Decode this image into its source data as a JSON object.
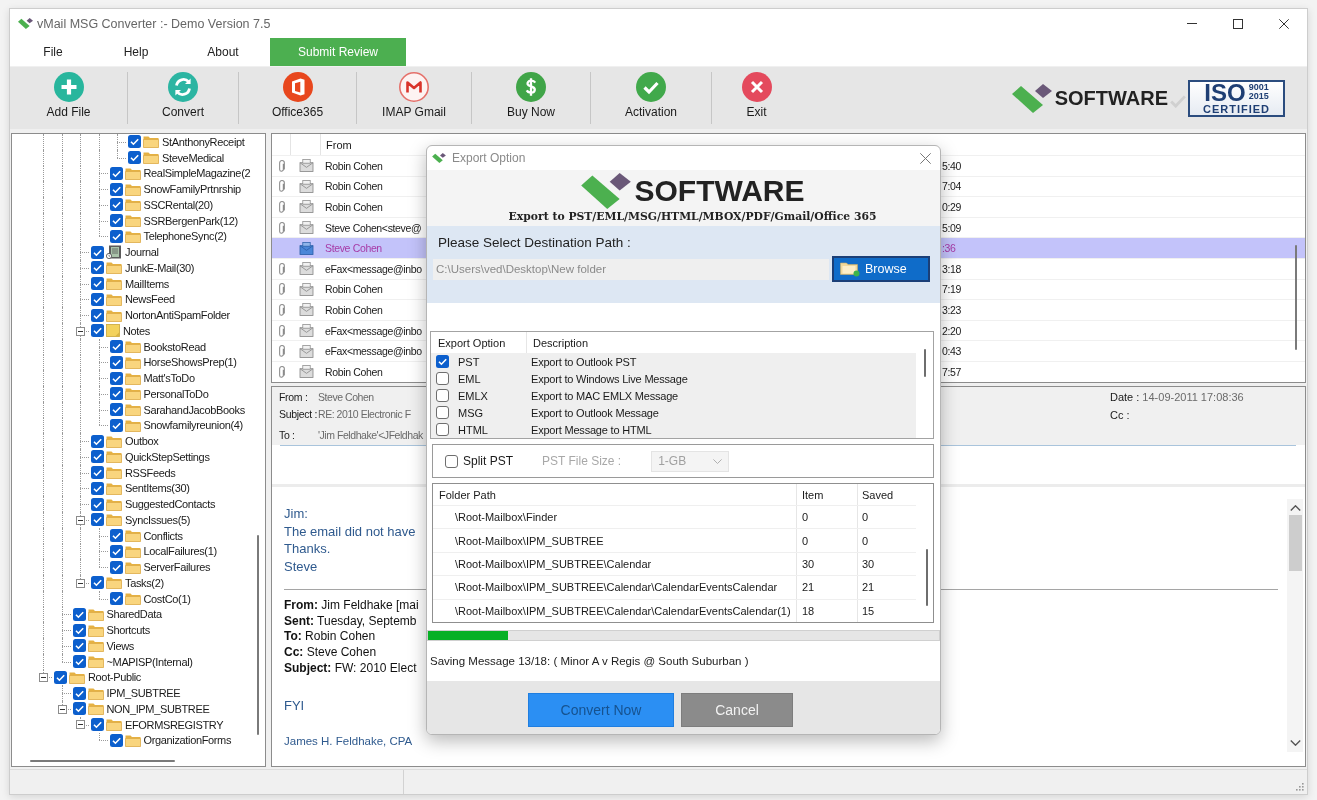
{
  "window": {
    "title": "vMail MSG Converter :- Demo Version 7.5"
  },
  "menu": [
    {
      "label": "File",
      "kind": "menu"
    },
    {
      "label": "Help",
      "kind": "menu"
    },
    {
      "label": "About",
      "kind": "menu"
    },
    {
      "label": "Submit Review",
      "kind": "action"
    }
  ],
  "toolbar": {
    "buttons": [
      {
        "label": "Add File",
        "kind": "add"
      },
      {
        "label": "Convert",
        "kind": "convert"
      },
      {
        "label": "Office365",
        "kind": "office"
      },
      {
        "label": "IMAP Gmail",
        "kind": "gmail"
      },
      {
        "label": "Buy Now",
        "kind": "buy"
      },
      {
        "label": "Activation",
        "kind": "activate"
      },
      {
        "label": "Exit",
        "kind": "exit"
      }
    ],
    "brand": "SOFTWARE",
    "iso_badge": {
      "mark": "ISO",
      "standard": "9001",
      "year": "2015",
      "caption": "CERTIFIED"
    }
  },
  "folder_tree": {
    "items": [
      {
        "children": [
          {
            "children": [
              {
                "children": [
                  {
                    "children": [
                      {
                        "label": "StAnthonyReceipt",
                        "kind": "folder",
                        "checked": true
                      },
                      {
                        "label": "SteveMedical",
                        "kind": "folder",
                        "checked": true
                      }
                    ]
                  },
                  {
                    "label": "RealSimpleMagazine(2",
                    "kind": "folder",
                    "checked": true
                  },
                  {
                    "label": "SnowFamilyPrtnrship",
                    "kind": "folder",
                    "checked": true
                  },
                  {
                    "label": "SSCRental(20)",
                    "kind": "folder",
                    "checked": true
                  },
                  {
                    "label": "SSRBergenPark(12)",
                    "kind": "folder",
                    "checked": true
                  },
                  {
                    "label": "TelephoneSync(2)",
                    "kind": "folder",
                    "checked": true
                  }
                ]
              },
              {
                "label": "Journal",
                "kind": "journal",
                "checked": true
              },
              {
                "label": "JunkE-Mail(30)",
                "kind": "folder",
                "checked": true
              },
              {
                "label": "MailItems",
                "kind": "folder",
                "checked": true
              },
              {
                "label": "NewsFeed",
                "kind": "folder",
                "checked": true
              },
              {
                "label": "NortonAntiSpamFolder",
                "kind": "folder",
                "checked": true
              },
              {
                "label": "Notes",
                "kind": "notes",
                "checked": true,
                "expanded": true,
                "children": [
                  {
                    "label": "BookstoRead",
                    "kind": "folder",
                    "checked": true
                  },
                  {
                    "label": "HorseShowsPrep(1)",
                    "kind": "folder",
                    "checked": true
                  },
                  {
                    "label": "Matt'sToDo",
                    "kind": "folder",
                    "checked": true
                  },
                  {
                    "label": "PersonalToDo",
                    "kind": "folder",
                    "checked": true
                  },
                  {
                    "label": "SarahandJacobBooks",
                    "kind": "folder",
                    "checked": true
                  },
                  {
                    "label": "Snowfamilyreunion(4)",
                    "kind": "folder",
                    "checked": true
                  }
                ]
              },
              {
                "label": "Outbox",
                "kind": "folder",
                "checked": true
              },
              {
                "label": "QuickStepSettings",
                "kind": "folder",
                "checked": true
              },
              {
                "label": "RSSFeeds",
                "kind": "folder",
                "checked": true
              },
              {
                "label": "SentItems(30)",
                "kind": "folder",
                "checked": true
              },
              {
                "label": "SuggestedContacts",
                "kind": "folder",
                "checked": true
              },
              {
                "label": "SyncIssues(5)",
                "kind": "folder",
                "checked": true,
                "expanded": true,
                "children": [
                  {
                    "label": "Conflicts",
                    "kind": "folder",
                    "checked": true
                  },
                  {
                    "label": "LocalFailures(1)",
                    "kind": "folder",
                    "checked": true
                  },
                  {
                    "label": "ServerFailures",
                    "kind": "folder",
                    "checked": true
                  }
                ]
              },
              {
                "label": "Tasks(2)",
                "kind": "folder",
                "checked": true,
                "expanded": true,
                "children": [
                  {
                    "label": "CostCo(1)",
                    "kind": "folder",
                    "checked": true
                  }
                ]
              }
            ]
          },
          {
            "label": "SharedData",
            "kind": "folder",
            "checked": true
          },
          {
            "label": "Shortcuts",
            "kind": "folder",
            "checked": true
          },
          {
            "label": "Views",
            "kind": "folder",
            "checked": true
          },
          {
            "label": "~MAPISP(Internal)",
            "kind": "folder",
            "checked": true
          }
        ]
      },
      {
        "label": "Root-Public",
        "kind": "folder",
        "checked": true,
        "expanded": true,
        "children": [
          {
            "label": "IPM_SUBTREE",
            "kind": "folder",
            "checked": true
          },
          {
            "label": "NON_IPM_SUBTREE",
            "kind": "folder",
            "checked": true,
            "expanded": true,
            "children": [
              {
                "label": "EFORMSREGISTRY",
                "kind": "folder",
                "checked": true,
                "expanded": true,
                "children": [
                  {
                    "label": "OrganizationForms",
                    "kind": "folder",
                    "checked": true
                  }
                ]
              }
            ]
          }
        ]
      }
    ]
  },
  "message_list": {
    "columns": [
      {
        "label": "From"
      }
    ],
    "rows": [
      {
        "attachment": true,
        "from": "Robin Cohen",
        "date": "5:40",
        "selected": false
      },
      {
        "attachment": true,
        "from": "Robin Cohen",
        "date": "7:04",
        "selected": false
      },
      {
        "attachment": true,
        "from": "Robin Cohen",
        "date": "0:29",
        "selected": false
      },
      {
        "attachment": true,
        "from": "Steve Cohen<steve@",
        "date": "5:09",
        "selected": false
      },
      {
        "attachment": false,
        "from": "Steve Cohen",
        "date": ":36",
        "selected": true
      },
      {
        "attachment": true,
        "from": "eFax<message@inbo",
        "date": "3:18",
        "selected": false
      },
      {
        "attachment": true,
        "from": "Robin Cohen",
        "date": "7:19",
        "selected": false
      },
      {
        "attachment": true,
        "from": "Robin Cohen",
        "date": "3:23",
        "selected": false
      },
      {
        "attachment": true,
        "from": "eFax<message@inbo",
        "date": "2:20",
        "selected": false
      },
      {
        "attachment": true,
        "from": "eFax<message@inbo",
        "date": "0:43",
        "selected": false
      },
      {
        "attachment": true,
        "from": "Robin Cohen",
        "date": "7:57",
        "selected": false
      }
    ]
  },
  "preview": {
    "fields": [
      {
        "label": "From :",
        "value": "Steve Cohen"
      },
      {
        "label": "Subject :",
        "value": "RE: 2010 Electronic F"
      },
      {
        "label": "To :",
        "value": "'Jim Feldhake'<JFeldhak"
      }
    ],
    "side_fields": [
      {
        "label": "Date :",
        "value": "14-09-2011 17:08:36"
      },
      {
        "label": "Cc :"
      }
    ],
    "body": [
      {
        "kind": "reply",
        "lines": [
          "Jim:",
          "The email did not have",
          "Thanks.",
          "Steve"
        ]
      },
      {
        "kind": "forwarded",
        "lines": [
          "**From:** Jim Feldhake [mai",
          "**Sent:** Tuesday, Septemb",
          "**To:** Robin Cohen",
          "**Cc:** Steve Cohen",
          "**Subject:** FW: 2010 Elect"
        ]
      },
      {
        "kind": "reply",
        "lines": [
          "FYI"
        ]
      },
      {
        "kind": "signature",
        "lines": [
          "James H. Feldhake, CPA"
        ]
      }
    ]
  },
  "export_dialog": {
    "title": "Export Option",
    "brand": "SOFTWARE",
    "tagline": "Export to PST/EML/MSG/HTML/MBOX/PDF/Gmail/Office 365",
    "destination": {
      "label": "Please Select Destination Path :",
      "value": "C:\\Users\\ved\\Desktop\\New folder",
      "button": "Browse"
    },
    "option_columns": [
      "Export Option",
      "Description"
    ],
    "options": [
      {
        "format": "PST",
        "description": "Export to Outlook PST",
        "checked": true
      },
      {
        "format": "EML",
        "description": "Export to Windows Live Message",
        "checked": false
      },
      {
        "format": "EMLX",
        "description": "Export to MAC EMLX Message",
        "checked": false
      },
      {
        "format": "MSG",
        "description": "Export to Outlook Message",
        "checked": false
      },
      {
        "format": "HTML",
        "description": "Export Message to HTML",
        "checked": false
      }
    ],
    "split_pst": {
      "label": "Split PST",
      "checked": false,
      "size_label": "PST File Size :",
      "size": "1-GB",
      "disabled": true
    },
    "folder_columns": [
      "Folder Path",
      "Item",
      "Saved"
    ],
    "folders": [
      {
        "path": "\\Root-Mailbox\\Finder",
        "item": "0",
        "saved": "0"
      },
      {
        "path": "\\Root-Mailbox\\IPM_SUBTREE",
        "item": "0",
        "saved": "0"
      },
      {
        "path": "\\Root-Mailbox\\IPM_SUBTREE\\Calendar",
        "item": "30",
        "saved": "30"
      },
      {
        "path": "\\Root-Mailbox\\IPM_SUBTREE\\Calendar\\CalendarEventsCalendar",
        "item": "21",
        "saved": "21"
      },
      {
        "path": "\\Root-Mailbox\\IPM_SUBTREE\\Calendar\\CalendarEventsCalendar(1)",
        "item": "18",
        "saved": "15"
      }
    ],
    "progress": {
      "level": 0.156
    },
    "status": "Saving Message 13/18: ( Minor A v Regis @ South Suburban )",
    "buttons": [
      {
        "label": "Convert Now",
        "kind": "primary"
      },
      {
        "label": "Cancel",
        "kind": "secondary"
      }
    ]
  }
}
